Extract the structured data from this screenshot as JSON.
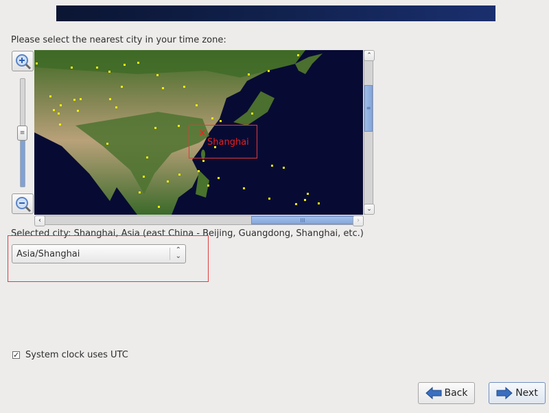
{
  "header": {
    "banner": ""
  },
  "prompt": "Please select the nearest city in your time zone:",
  "map": {
    "selected_city_marker": "Shanghai",
    "marker_icon": "x-marker",
    "highlight_color": "#e23a3a",
    "city_dot_color": "#f0f000"
  },
  "zoom_controls": {
    "zoom_in": "zoom-in",
    "zoom_out": "zoom-out",
    "level_fraction": 0.45
  },
  "scrollbars": {
    "vertical_position_fraction": 0.3,
    "horizontal_position_fraction": 0.75
  },
  "selected_city": "Selected city: Shanghai, Asia (east China - Beijing, Guangdong, Shanghai, etc.)",
  "timezone_select": {
    "value": "Asia/Shanghai"
  },
  "utc_checkbox": {
    "label": "System clock uses UTC",
    "checked": true
  },
  "buttons": {
    "back": "Back",
    "next": "Next"
  },
  "colors": {
    "banner_start": "#0b1533",
    "banner_end": "#1a2f6e",
    "accent": "#7ea2d8"
  }
}
